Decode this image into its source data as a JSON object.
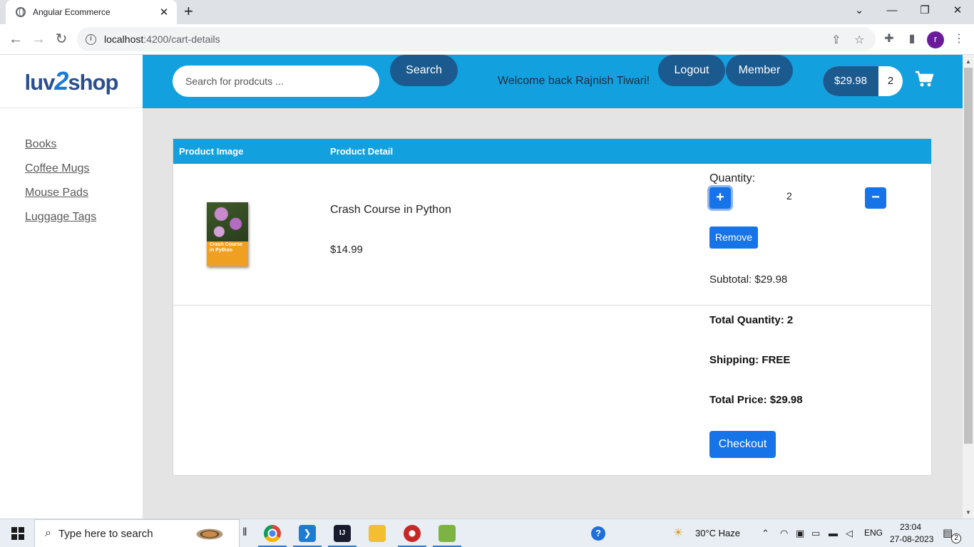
{
  "browser": {
    "tab_title": "Angular Ecommerce",
    "url_host": "localhost",
    "url_path": ":4200/cart-details",
    "profile_initial": "r"
  },
  "sidebar": {
    "logo_left": "luv",
    "logo_mid": "2",
    "logo_right": "shop",
    "items": [
      {
        "label": "Books"
      },
      {
        "label": "Coffee Mugs"
      },
      {
        "label": "Mouse Pads"
      },
      {
        "label": "Luggage Tags"
      }
    ]
  },
  "header": {
    "search_placeholder": "Search for prodcuts ...",
    "search_button": "Search",
    "welcome": "Welcome back Rajnish Tiwari!",
    "logout": "Logout",
    "member": "Member",
    "cart_total": "$29.98",
    "cart_count": "2"
  },
  "cart": {
    "col_image": "Product Image",
    "col_detail": "Product Detail",
    "item": {
      "cover_title": "Crash Course in Python",
      "name": "Crash Course in Python",
      "price": "$14.99",
      "quantity_label": "Quantity:",
      "quantity": "2",
      "remove": "Remove",
      "subtotal": "Subtotal: $29.98"
    },
    "summary": {
      "total_quantity": "Total Quantity: 2",
      "shipping": "Shipping: FREE",
      "total_price": "Total Price: $29.98",
      "checkout": "Checkout"
    }
  },
  "taskbar": {
    "search_text": "Type here to search",
    "weather": "30°C  Haze",
    "language": "ENG",
    "time": "23:04",
    "date": "27-08-2023",
    "notifications": "2"
  },
  "colors": {
    "header_blue": "#13a0df",
    "pill_dark": "#1b5a8f",
    "button_blue": "#1673e8"
  }
}
